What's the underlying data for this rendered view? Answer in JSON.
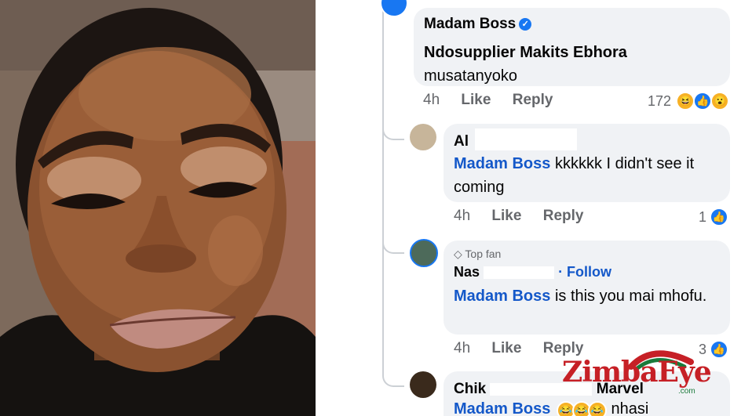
{
  "comments": [
    {
      "name": "Madam Boss",
      "verified": true,
      "mention": "Ndosupplier Makits Ebhora",
      "text": "musatanyoko",
      "time": "4h",
      "like_label": "Like",
      "reply_label": "Reply",
      "reaction_count": "172"
    },
    {
      "name": "Al",
      "mention": "Madam Boss",
      "text": "kkkkkk I didn't see it coming",
      "time": "4h",
      "like_label": "Like",
      "reply_label": "Reply",
      "reaction_count": "1"
    },
    {
      "badge": "Top fan",
      "name": "Nas",
      "name_tail": "· Follow",
      "mention": "Madam Boss",
      "text": "is this you mai mhofu.",
      "time": "4h",
      "like_label": "Like",
      "reply_label": "Reply",
      "reaction_count": "3"
    },
    {
      "name": "Chik",
      "name_tail": "Marvel",
      "mention": "Madam Boss",
      "text": "nhasi"
    }
  ],
  "watermark": {
    "text": "ZimbaEye",
    "domain": ".com"
  },
  "colors": {
    "link": "#1458c9",
    "bubble": "#f0f2f5",
    "meta": "#65676b",
    "watermark": "#c62026"
  }
}
